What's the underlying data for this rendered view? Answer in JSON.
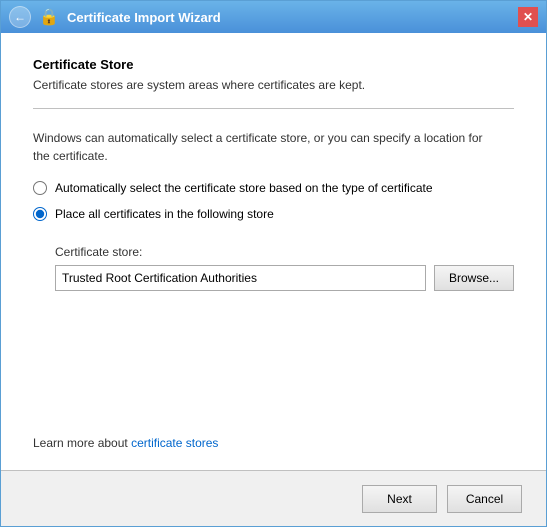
{
  "window": {
    "title": "Certificate Import Wizard",
    "close_label": "✕"
  },
  "header": {
    "section_title": "Certificate Store",
    "section_desc": "Certificate stores are system areas where certificates are kept."
  },
  "info_text_blue": "Windows can automatically select a certificate store, or you can specify a location for",
  "info_text_black": "the certificate.",
  "radio_options": [
    {
      "id": "auto",
      "label": "Automatically select the certificate store based on the type of certificate",
      "checked": false
    },
    {
      "id": "manual",
      "label": "Place all certificates in the following store",
      "checked": true
    }
  ],
  "store": {
    "label": "Certificate store:",
    "value": "Trusted Root Certification Authorities",
    "browse_label": "Browse..."
  },
  "learn_more": {
    "prefix": "Learn more about ",
    "link_text": "certificate stores"
  },
  "footer": {
    "next_label": "Next",
    "cancel_label": "Cancel"
  }
}
